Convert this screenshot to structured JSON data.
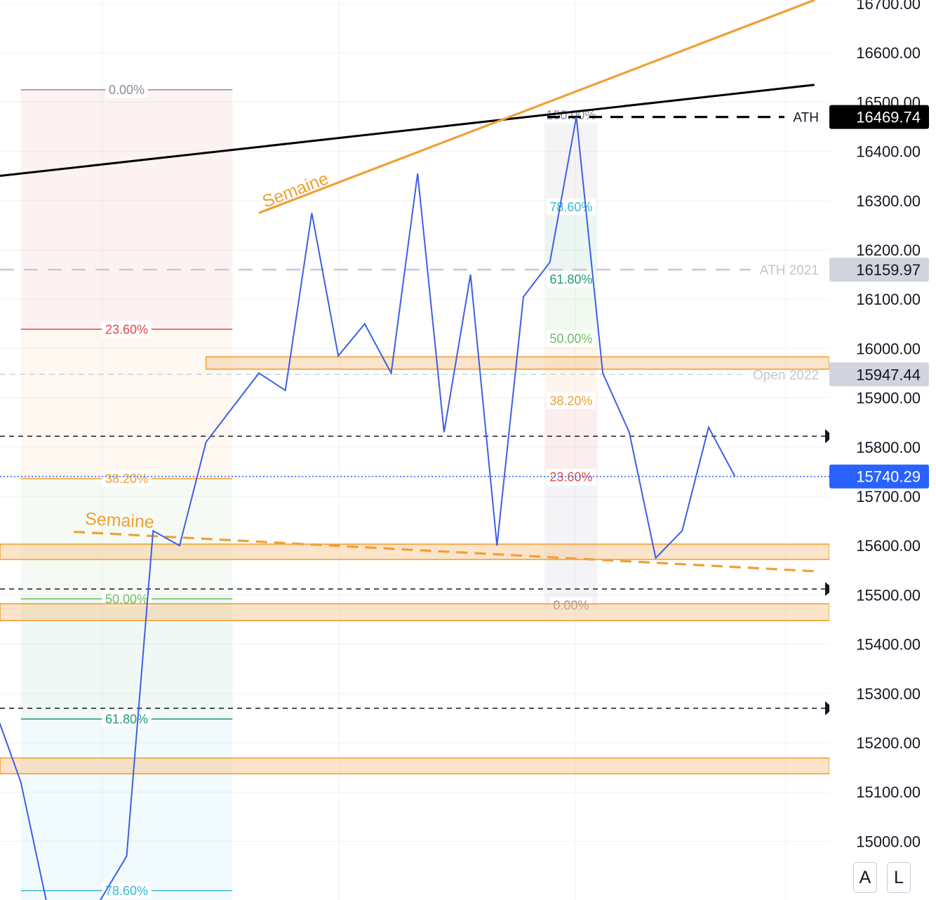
{
  "chart_data": {
    "type": "line",
    "ylim": [
      14883,
      16712
    ],
    "yticks": [
      15000,
      15100,
      15200,
      15300,
      15400,
      15500,
      15600,
      15700,
      15800,
      15900,
      16000,
      16100,
      16200,
      16300,
      16400,
      16500,
      16600,
      16700
    ],
    "series": [
      {
        "color": "#3d5fe6",
        "values": [
          15270,
          15120,
          14870,
          14830,
          14880,
          14970,
          15630,
          15600,
          15810,
          15880,
          15950,
          15915,
          16275,
          15985,
          16050,
          15950,
          16355,
          15830,
          16150,
          15600,
          16105,
          16175,
          16470,
          15950,
          15830,
          15575,
          15630,
          15840,
          15740
        ]
      }
    ],
    "price_labels": [
      {
        "text": "16469.74",
        "value": 16469.74,
        "bg": "#000000",
        "fg": "#ffffff"
      },
      {
        "text": "16159.97",
        "value": 16159.97,
        "bg": "#d1d4dc",
        "fg": "#131722"
      },
      {
        "text": "15947.44",
        "value": 15947.44,
        "bg": "#d1d4dc",
        "fg": "#131722"
      },
      {
        "text": "15740.29",
        "value": 15740.29,
        "bg": "#2962ff",
        "fg": "#ffffff"
      }
    ],
    "hlines": [
      {
        "name": "ath",
        "value": 16469.74,
        "label": "ATH",
        "color": "#000000",
        "style": "dash-heavy"
      },
      {
        "name": "ath-2021",
        "value": 16159.97,
        "label": "ATH 2021",
        "color": "#c7c9d1",
        "style": "dash-long"
      },
      {
        "name": "open-2022",
        "value": 15947.44,
        "label": "Open 2022",
        "color": "#d0d2d8",
        "style": "dash-light"
      },
      {
        "name": "level-1",
        "value": 15822,
        "label": "",
        "color": "#131722",
        "style": "dash-thin",
        "arrow": true
      },
      {
        "name": "level-2",
        "value": 15512,
        "label": "",
        "color": "#131722",
        "style": "dash-thin",
        "arrow": true
      },
      {
        "name": "level-3",
        "value": 15270,
        "label": "",
        "color": "#131722",
        "style": "dash-thin",
        "arrow": true
      },
      {
        "name": "last-price",
        "value": 15740.29,
        "label": "",
        "color": "#2962ff",
        "style": "dotted"
      }
    ],
    "zones": [
      {
        "name": "zone-16000",
        "top": 15983,
        "bottom": 15958,
        "start_bar": 8
      },
      {
        "name": "zone-15600",
        "top": 15603,
        "bottom": 15572,
        "start_bar": -1
      },
      {
        "name": "zone-15500",
        "top": 15482,
        "bottom": 15448,
        "start_bar": -1
      },
      {
        "name": "zone-15150",
        "top": 15169,
        "bottom": 15137,
        "start_bar": -1
      }
    ],
    "trendlines": [
      {
        "name": "black-resistance",
        "from": [
          -1,
          16343
        ],
        "to": [
          31,
          16535
        ],
        "color": "#000000",
        "dashed": false
      },
      {
        "name": "weekly-resistance",
        "from": [
          10,
          16275
        ],
        "to": [
          31,
          16707
        ],
        "color": "#f0a035",
        "dashed": false,
        "label": "Semaine"
      },
      {
        "name": "weekly-support",
        "from": [
          3,
          15628
        ],
        "to": [
          31,
          15548
        ],
        "color": "#f0a035",
        "dashed": true,
        "label": "Semaine"
      }
    ],
    "fib_left": {
      "start_bar": 1,
      "end_bar": 9,
      "levels": [
        {
          "label": "0.00%",
          "value": 16525,
          "color": "#8a8aa0"
        },
        {
          "label": "23.60%",
          "value": 16039,
          "color": "#e04848"
        },
        {
          "label": "38.20%",
          "value": 15736,
          "color": "#f0a035"
        },
        {
          "label": "50.00%",
          "value": 15492,
          "color": "#6cbc5e"
        },
        {
          "label": "61.80%",
          "value": 15248,
          "color": "#1f9a78"
        },
        {
          "label": "78.60%",
          "value": 14900,
          "color": "#36b8d0"
        }
      ]
    },
    "fib_right": {
      "start_bar": 20.8,
      "end_bar": 22.8,
      "levels": [
        {
          "label": "100.00%",
          "value": 16469.74,
          "color": "#8a8aa0"
        },
        {
          "label": "78.60%",
          "value": 16283,
          "color": "#36b8d0"
        },
        {
          "label": "61.80%",
          "value": 16136,
          "color": "#1f9a78"
        },
        {
          "label": "50.00%",
          "value": 16016,
          "color": "#6cbc5e"
        },
        {
          "label": "38.20%",
          "value": 15890,
          "color": "#f0a035"
        },
        {
          "label": "23.60%",
          "value": 15735,
          "color": "#e04848"
        },
        {
          "label": "0.00%",
          "value": 15475,
          "color": "#8a8aa0"
        }
      ]
    }
  },
  "controls": {
    "auto_label": "A",
    "log_label": "L"
  }
}
